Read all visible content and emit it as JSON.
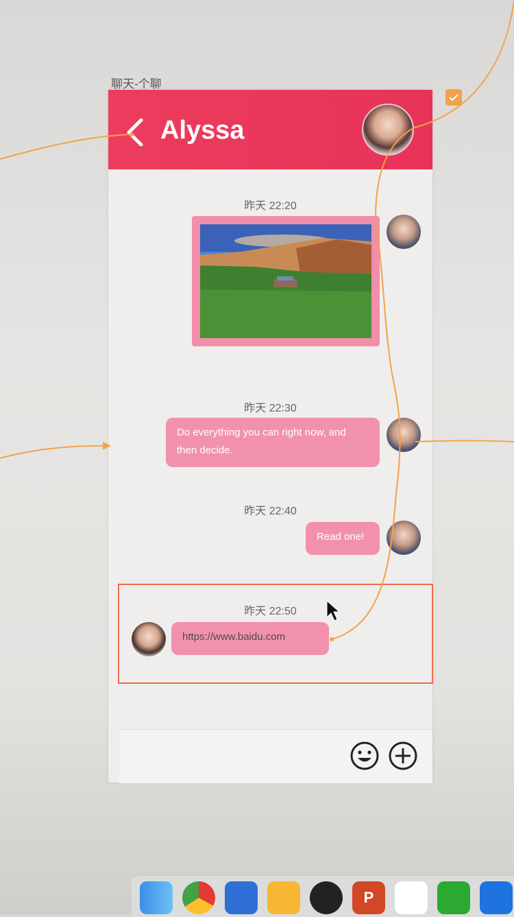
{
  "artboard": {
    "label": "聊天-个聊"
  },
  "header": {
    "title": "Alyssa"
  },
  "messages": [
    {
      "time": "昨天 22:20",
      "type": "image",
      "side": "right"
    },
    {
      "time": "昨天 22:30",
      "type": "text",
      "side": "right",
      "text": "Do everything you can right now, and then decide."
    },
    {
      "time": "昨天 22:40",
      "type": "text",
      "side": "right",
      "text": "Read one!"
    },
    {
      "time": "昨天 22:50",
      "type": "link",
      "side": "left",
      "text": "https://www.baidu.com"
    }
  ],
  "input": {
    "value": "",
    "placeholder": ""
  },
  "icons": {
    "back": "chevron-left-icon",
    "emoji": "smiley-icon",
    "add": "plus-circle-icon"
  },
  "colors": {
    "header": "#e8375a",
    "bubble": "#f291ad",
    "selection": "#ee6a4a",
    "prototype_link": "#f3a24b"
  },
  "dock": {
    "apps": [
      "finder",
      "chrome",
      "xcode",
      "sketch",
      "qq",
      "powerpoint",
      "baidu-netdisk",
      "wechat",
      "app-store"
    ]
  }
}
